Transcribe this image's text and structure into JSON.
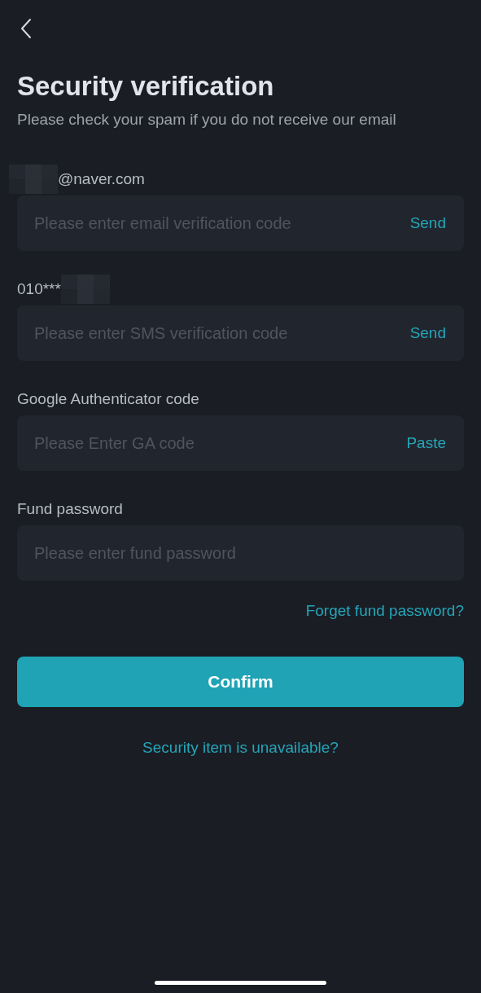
{
  "title": "Security verification",
  "subtitle": "Please check your spam if you do not receive our email",
  "fields": [
    {
      "label": "@naver.com",
      "kind": "email",
      "placeholder": "Please enter email verification code",
      "action": "Send"
    },
    {
      "label": "010***",
      "kind": "phone",
      "placeholder": "Please enter SMS verification code",
      "action": "Send"
    },
    {
      "label": "Google Authenticator code",
      "kind": "plain",
      "placeholder": "Please Enter GA code",
      "action": "Paste"
    },
    {
      "label": "Fund password",
      "kind": "plain",
      "placeholder": "Please enter fund password"
    }
  ],
  "forgot_link": "Forget fund password?",
  "confirm_button": "Confirm",
  "unavailable_link": "Security item is unavailable?"
}
